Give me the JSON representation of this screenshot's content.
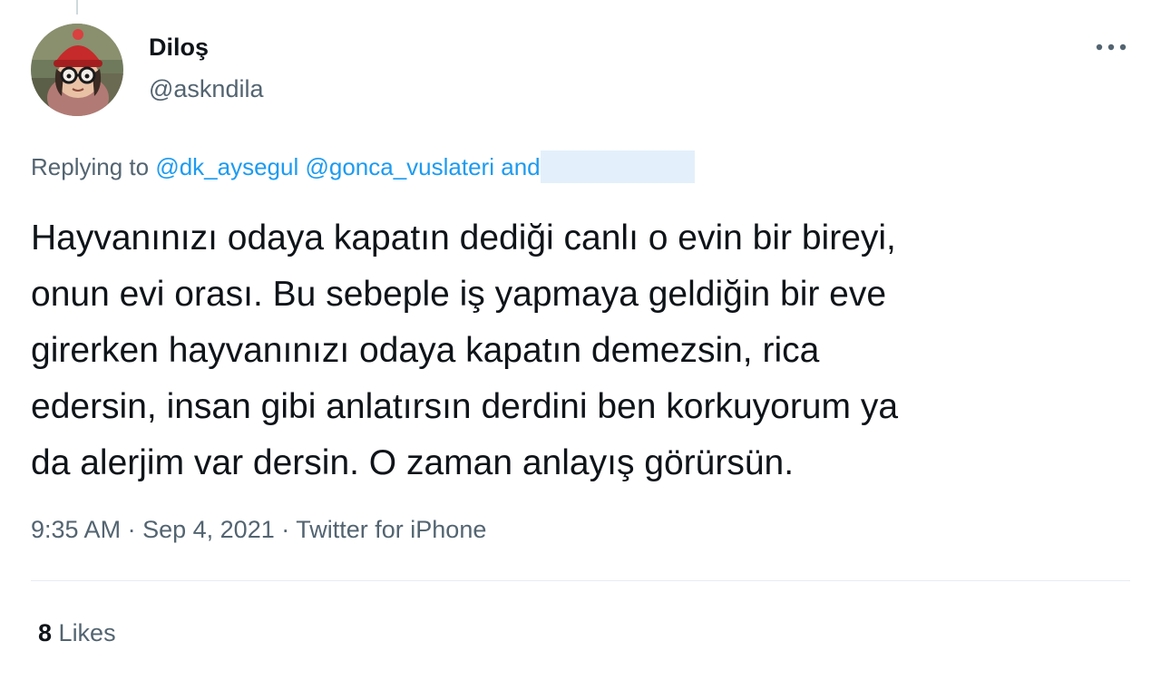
{
  "tweet": {
    "author": {
      "display_name": "Diloş",
      "handle": "@askndila"
    },
    "reply_context": {
      "prefix": "Replying to",
      "mentions": [
        "@dk_aysegul",
        "@gonca_vuslateri"
      ],
      "suffix": "and"
    },
    "text": "Hayvanınızı odaya kapatın dediği canlı o evin bir bireyi,\nonun evi orası. Bu sebeple iş yapmaya geldiğin bir eve\ngirerken hayvanınızı odaya kapatın demezsin, rica\nedersin, insan gibi anlatırsın derdini ben korkuyorum ya\nda alerjim var dersin. O zaman anlayış görürsün.",
    "time": "9:35 AM",
    "date": "Sep 4, 2021",
    "separator": "·",
    "source": "Twitter for iPhone",
    "likes_count": "8",
    "likes_label": "Likes"
  },
  "icons": {
    "more": "more-horizontal-icon"
  },
  "colors": {
    "text_primary": "#0f1419",
    "text_secondary": "#536471",
    "link": "#1d9bf0",
    "divider": "#e6ecf0"
  }
}
